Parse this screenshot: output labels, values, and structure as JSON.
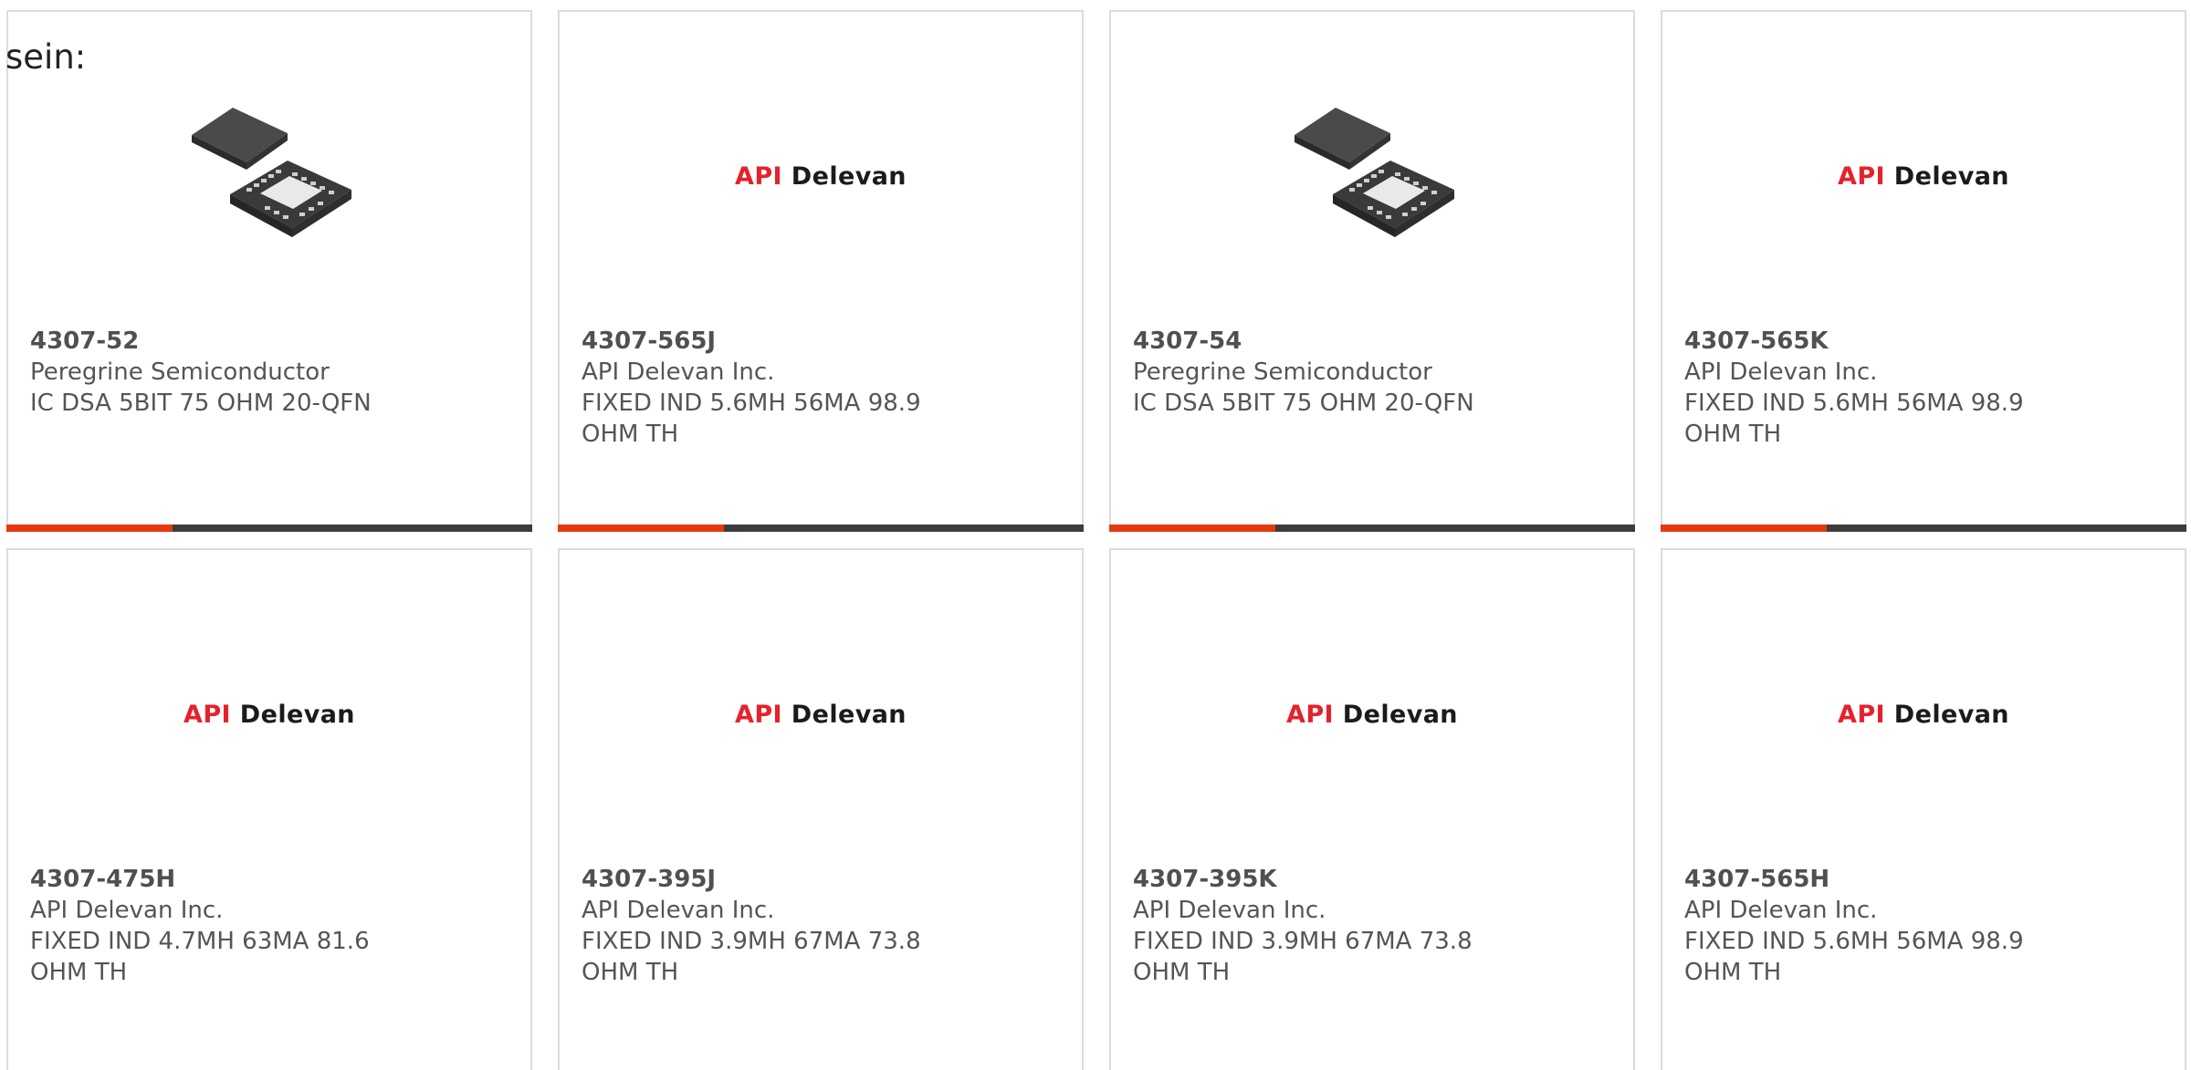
{
  "intro_text": "sein:",
  "cards": [
    {
      "part": "4307-52",
      "manufacturer": "Peregrine Semiconductor",
      "description": "IC DSA 5BIT 75 OHM 20-QFN",
      "image": "qfn-chip-image"
    },
    {
      "part": "4307-565J",
      "manufacturer": "API Delevan Inc.",
      "description": "FIXED IND 5.6MH 56MA 98.9 OHM TH",
      "image": "api-delevan-logo"
    },
    {
      "part": "4307-54",
      "manufacturer": "Peregrine Semiconductor",
      "description": "IC DSA 5BIT 75 OHM 20-QFN",
      "image": "qfn-chip-image"
    },
    {
      "part": "4307-565K",
      "manufacturer": "API Delevan Inc.",
      "description": "FIXED IND 5.6MH 56MA 98.9 OHM TH",
      "image": "api-delevan-logo"
    },
    {
      "part": "4307-475H",
      "manufacturer": "API Delevan Inc.",
      "description": "FIXED IND 4.7MH 63MA 81.6 OHM TH",
      "image": "api-delevan-logo"
    },
    {
      "part": "4307-395J",
      "manufacturer": "API Delevan Inc.",
      "description": "FIXED IND 3.9MH 67MA 73.8 OHM TH",
      "image": "api-delevan-logo"
    },
    {
      "part": "4307-395K",
      "manufacturer": "API Delevan Inc.",
      "description": "FIXED IND 3.9MH 67MA 73.8 OHM TH",
      "image": "api-delevan-logo"
    },
    {
      "part": "4307-565H",
      "manufacturer": "API Delevan Inc.",
      "description": "FIXED IND 5.6MH 56MA 98.9 OHM TH",
      "image": "api-delevan-logo"
    }
  ],
  "logo": {
    "red": "API",
    "dark": "Delevan"
  },
  "colors": {
    "accent": "#e6390f",
    "bar": "#3c3c3c",
    "logo_red": "#e5222b",
    "border": "#dcdcdc",
    "text": "#555555"
  }
}
